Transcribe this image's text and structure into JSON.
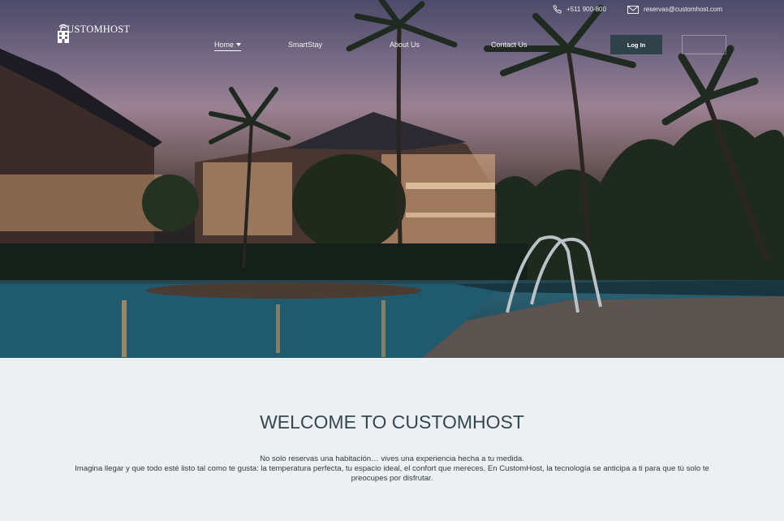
{
  "header": {
    "phone": "+511 900-800",
    "email": "reservas@customhost.com",
    "logo_text": "CUSTOMHOST"
  },
  "nav": {
    "items": [
      {
        "label": "Home",
        "active": true
      },
      {
        "label": "SmartStay"
      },
      {
        "label": "About Us"
      },
      {
        "label": "Contact Us"
      }
    ],
    "login_label": "Log In"
  },
  "icons": {
    "phone": "phone-icon",
    "email": "envelope-icon",
    "logo": "hotel-building-icon",
    "caret": "caret-down-icon"
  },
  "welcome": {
    "title": "WELCOME TO CUSTOMHOST",
    "line1": "No solo reservas una habitación… vives una experiencia hecha a tu medida.",
    "line2": "Imagina llegar y que todo esté listo tal como te gusta: la temperatura perfecta, tu espacio ideal, el confort que mereces. En CustomHost, la tecnología se anticipa a ti para que tú solo te preocupes por disfrutar."
  },
  "colors": {
    "background": "#edf0f3",
    "title": "#35474f",
    "login_button": "#2f4149"
  }
}
